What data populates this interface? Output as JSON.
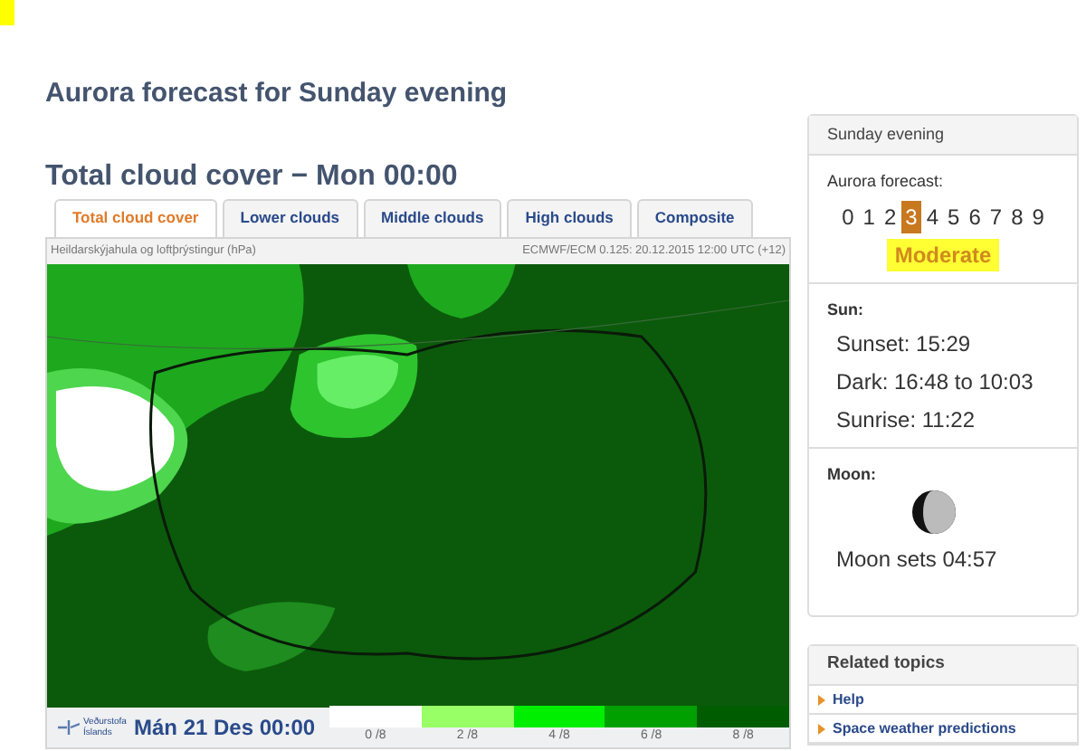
{
  "page_title": "Aurora forecast for Sunday evening",
  "cloud_title": "Total cloud cover − Mon 00:00",
  "tabs": [
    {
      "label": "Total cloud cover",
      "selected": true
    },
    {
      "label": "Lower clouds",
      "selected": false
    },
    {
      "label": "Middle clouds",
      "selected": false
    },
    {
      "label": "High clouds",
      "selected": false
    },
    {
      "label": "Composite",
      "selected": false
    }
  ],
  "map": {
    "caption_left": "Heildarskýjahula og loftþrýstingur (hPa)",
    "caption_right": "ECMWF/ECM 0.125: 20.12.2015 12:00 UTC (+12)",
    "logo_text": "Veðurstofa Íslands",
    "time": "Mán 21 Des 00:00",
    "legend": [
      {
        "label": "0 /8",
        "color": "#ffffff"
      },
      {
        "label": "2 /8",
        "color": "#99ff66"
      },
      {
        "label": "4 /8",
        "color": "#00ee00"
      },
      {
        "label": "6 /8",
        "color": "#00a000"
      },
      {
        "label": "8 /8",
        "color": "#005c00"
      }
    ]
  },
  "sidebar": {
    "heading": "Sunday evening",
    "aurora_label": "Aurora forecast:",
    "scale": [
      {
        "label": "0",
        "selected": false
      },
      {
        "label": "1",
        "selected": false
      },
      {
        "label": "2",
        "selected": false
      },
      {
        "label": "3",
        "selected": true
      },
      {
        "label": "4",
        "selected": false
      },
      {
        "label": "5",
        "selected": false
      },
      {
        "label": "6",
        "selected": false
      },
      {
        "label": "7",
        "selected": false
      },
      {
        "label": "8",
        "selected": false
      },
      {
        "label": "9",
        "selected": false
      }
    ],
    "activity": "Moderate",
    "sun_label": "Sun:",
    "sun_lines": [
      "Sunset: 15:29",
      "Dark: 16:48 to 10:03",
      "Sunrise: 11:22"
    ],
    "moon_label": "Moon:",
    "moon_text": "Moon sets 04:57"
  },
  "related": {
    "heading": "Related topics",
    "links": [
      "Help",
      "Space weather predictions"
    ]
  }
}
